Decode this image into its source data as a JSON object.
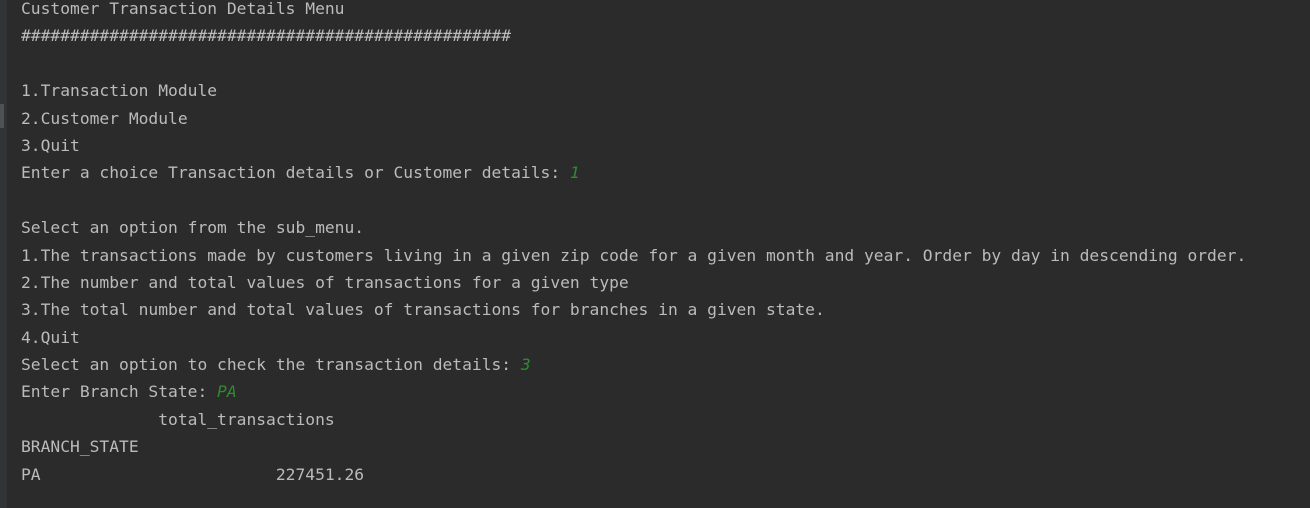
{
  "console": {
    "lines": [
      "Customer Transaction Details Menu",
      "##################################################",
      "",
      "1.Transaction Module",
      "2.Customer Module",
      "3.Quit",
      "Enter a choice Transaction details or Customer details: ",
      "",
      "Select an option from the sub_menu.",
      "1.The transactions made by customers living in a given zip code for a given month and year. Order by day in descending order.",
      "2.The number and total values of transactions for a given type",
      "3.The total number and total values of transactions for branches in a given state.",
      "4.Quit",
      "Select an option to check the transaction details: ",
      "Enter Branch State: ",
      "              total_transactions",
      "BRANCH_STATE",
      "PA                        227451.26"
    ],
    "inputs": {
      "main_choice": "1",
      "sub_option": "3",
      "branch_state": "PA"
    }
  },
  "colors": {
    "background": "#2b2b2b",
    "text": "#bbbbbb",
    "user_input": "#2e8b2e"
  }
}
